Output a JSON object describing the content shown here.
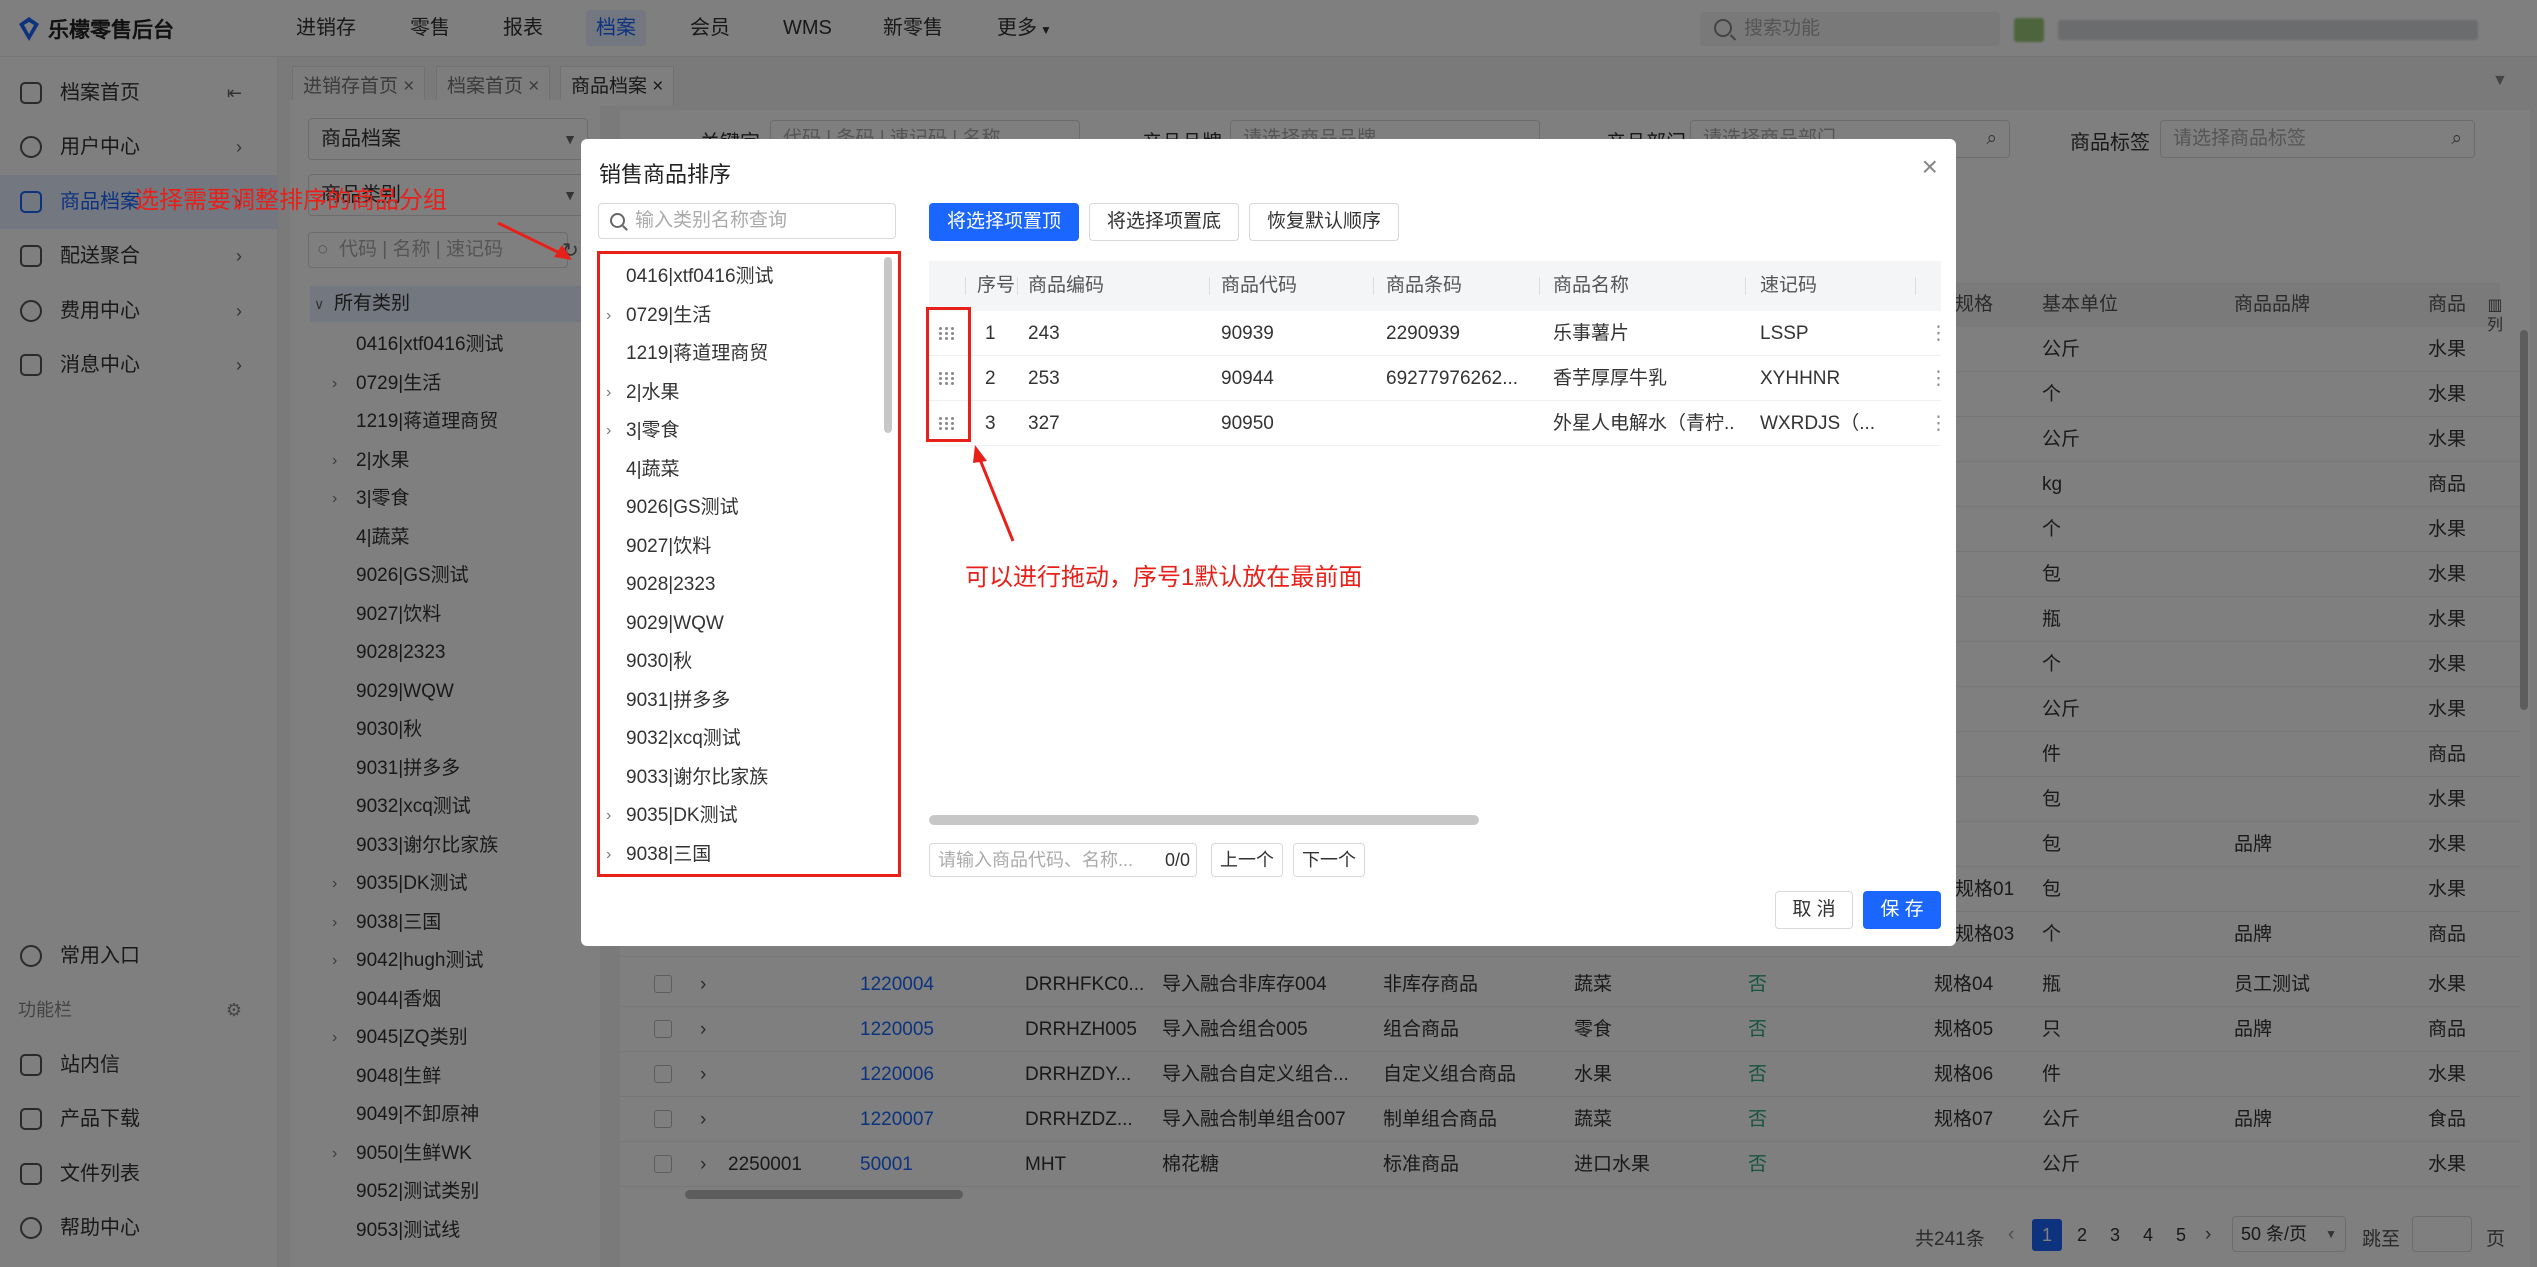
{
  "app": {
    "logo_text": "乐檬零售后台"
  },
  "top_nav": [
    "进销存",
    "零售",
    "报表",
    "档案",
    "会员",
    "WMS",
    "新零售",
    "更多"
  ],
  "top_search": {
    "placeholder": "搜索功能"
  },
  "sidebar": {
    "items": [
      {
        "label": "档案首页",
        "icon": "home-icon"
      },
      {
        "label": "用户中心",
        "icon": "user-icon"
      },
      {
        "label": "商品档案",
        "icon": "product-icon",
        "active": true
      },
      {
        "label": "配送聚合",
        "icon": "delivery-icon"
      },
      {
        "label": "费用中心",
        "icon": "expense-icon"
      },
      {
        "label": "消息中心",
        "icon": "bell-icon"
      }
    ],
    "bottom": [
      {
        "label": "常用入口",
        "icon": "heart-icon"
      },
      {
        "label": "功能栏",
        "icon": "settings-icon"
      },
      {
        "label": "站内信",
        "icon": "mail-icon"
      },
      {
        "label": "产品下载",
        "icon": "download-icon"
      },
      {
        "label": "文件列表",
        "icon": "file-icon"
      },
      {
        "label": "帮助中心",
        "icon": "help-icon"
      }
    ]
  },
  "tabs": [
    "进销存首页",
    "档案首页",
    "商品档案"
  ],
  "category_panel": {
    "select1": "商品档案",
    "select2": "商品类别",
    "search_placeholder": "代码 | 名称 | 速记码",
    "root": "所有类别",
    "items": [
      "0416|xtf0416测试",
      "0729|生活",
      "1219|蒋道理商贸",
      "2|水果",
      "3|零食",
      "4|蔬菜",
      "9026|GS测试",
      "9027|饮料",
      "9028|2323",
      "9029|WQW",
      "9030|秋",
      "9031|拼多多",
      "9032|xcq测试",
      "9033|谢尔比家族",
      "9035|DK测试",
      "9038|三国",
      "9042|hugh测试",
      "9044|香烟",
      "9045|ZQ类别",
      "9048|生鲜",
      "9049|不卸原神",
      "9050|生鲜WK",
      "9052|测试类别",
      "9053|测试线"
    ]
  },
  "filters": {
    "keyword_label": "关键字",
    "keyword_placeholder": "代码 | 条码 | 速记码 | 名称",
    "brand_label": "产品品牌",
    "brand_placeholder": "请选择商品品牌",
    "dept_label": "产品部门",
    "dept_placeholder": "请选择商品部门",
    "tag_label": "商品标签",
    "tag_placeholder": "请选择商品标签"
  },
  "main_table": {
    "headers": [
      "规格",
      "基本单位",
      "商品品牌",
      "商品"
    ],
    "col_button": "列",
    "top_rows": [
      {
        "unit": "公斤",
        "brand": "",
        "cat": "水果"
      },
      {
        "unit": "个",
        "brand": "",
        "cat": "水果"
      },
      {
        "unit": "公斤",
        "brand": "",
        "cat": "水果"
      },
      {
        "unit": "kg",
        "brand": "",
        "cat": "商品"
      },
      {
        "unit": "个",
        "brand": "",
        "cat": "水果"
      },
      {
        "unit": "包",
        "brand": "",
        "cat": "水果"
      },
      {
        "unit": "瓶",
        "brand": "",
        "cat": "水果"
      },
      {
        "unit": "个",
        "brand": "",
        "cat": "水果"
      },
      {
        "unit": "公斤",
        "brand": "",
        "cat": "水果"
      },
      {
        "unit": "件",
        "brand": "",
        "cat": "商品"
      },
      {
        "unit": "包",
        "brand": "",
        "cat": "水果"
      },
      {
        "unit": "包",
        "brand": "品牌",
        "cat": "水果"
      },
      {
        "spec": "规格01",
        "unit": "包",
        "brand": "",
        "cat": "水果"
      },
      {
        "spec": "规格03",
        "unit": "个",
        "brand": "品牌",
        "cat": "商品"
      }
    ],
    "rows": [
      {
        "barcode": "",
        "code": "1220004",
        "sku": "DRRHFKC0...",
        "name": "导入融合非库存004",
        "type": "非库存商品",
        "category": "蔬菜",
        "flag": "否",
        "spec": "规格04",
        "unit": "瓶",
        "brand": "员工测试",
        "cat": "水果"
      },
      {
        "barcode": "",
        "code": "1220005",
        "sku": "DRRHZH005",
        "name": "导入融合组合005",
        "type": "组合商品",
        "category": "零食",
        "flag": "否",
        "spec": "规格05",
        "unit": "只",
        "brand": "品牌",
        "cat": "商品"
      },
      {
        "barcode": "",
        "code": "1220006",
        "sku": "DRRHZDY...",
        "name": "导入融合自定义组合...",
        "type": "自定义组合商品",
        "category": "水果",
        "flag": "否",
        "spec": "规格06",
        "unit": "件",
        "brand": "",
        "cat": "水果"
      },
      {
        "barcode": "",
        "code": "1220007",
        "sku": "DRRHZDZ...",
        "name": "导入融合制单组合007",
        "type": "制单组合商品",
        "category": "蔬菜",
        "flag": "否",
        "spec": "规格07",
        "unit": "公斤",
        "brand": "品牌",
        "cat": "食品"
      },
      {
        "barcode": "2250001",
        "code": "50001",
        "sku": "MHT",
        "name": "棉花糖",
        "type": "标准商品",
        "category": "进口水果",
        "flag": "否",
        "spec": "",
        "unit": "公斤",
        "brand": "",
        "cat": "水果"
      }
    ]
  },
  "pagination": {
    "total": "共241条",
    "pages": [
      "1",
      "2",
      "3",
      "4",
      "5"
    ],
    "page_size": "50 条/页",
    "jump_label": "跳至",
    "page_unit": "页"
  },
  "dialog": {
    "title": "销售商品排序",
    "search_placeholder": "输入类别名称查询",
    "tree": [
      {
        "label": "0416|xtf0416测试",
        "expandable": false
      },
      {
        "label": "0729|生活",
        "expandable": true
      },
      {
        "label": "1219|蒋道理商贸",
        "expandable": false
      },
      {
        "label": "2|水果",
        "expandable": true
      },
      {
        "label": "3|零食",
        "expandable": true
      },
      {
        "label": "4|蔬菜",
        "expandable": false
      },
      {
        "label": "9026|GS测试",
        "expandable": false
      },
      {
        "label": "9027|饮料",
        "expandable": false
      },
      {
        "label": "9028|2323",
        "expandable": false
      },
      {
        "label": "9029|WQW",
        "expandable": false
      },
      {
        "label": "9030|秋",
        "expandable": false
      },
      {
        "label": "9031|拼多多",
        "expandable": false
      },
      {
        "label": "9032|xcq测试",
        "expandable": false
      },
      {
        "label": "9033|谢尔比家族",
        "expandable": false
      },
      {
        "label": "9035|DK测试",
        "expandable": true
      },
      {
        "label": "9038|三国",
        "expandable": true
      }
    ],
    "buttons": {
      "top": "将选择项置顶",
      "bottom": "将选择项置底",
      "reset": "恢复默认顺序"
    },
    "table_headers": [
      "序号",
      "商品编码",
      "商品代码",
      "商品条码",
      "商品名称",
      "速记码"
    ],
    "rows": [
      {
        "seq": "1",
        "code": "243",
        "sku": "90939",
        "barcode": "2290939",
        "name": "乐事薯片",
        "short": "LSSP"
      },
      {
        "seq": "2",
        "code": "253",
        "sku": "90944",
        "barcode": "69277976262...",
        "name": "香芋厚厚牛乳",
        "short": "XYHHNR"
      },
      {
        "seq": "3",
        "code": "327",
        "sku": "90950",
        "barcode": "",
        "name": "外星人电解水（青柠...",
        "short": "WXRDJS（..."
      }
    ],
    "find_placeholder": "请输入商品代码、名称...",
    "find_count": "0/0",
    "prev": "上一个",
    "next": "下一个",
    "cancel": "取 消",
    "save": "保 存"
  },
  "annotations": {
    "left": "选择需要调整排序的商品分组",
    "right": "可以进行拖动，序号1默认放在最前面"
  },
  "colors": {
    "primary": "#1a66ff",
    "annotation_red": "#e8201a",
    "flag_green": "#2ea87a"
  }
}
